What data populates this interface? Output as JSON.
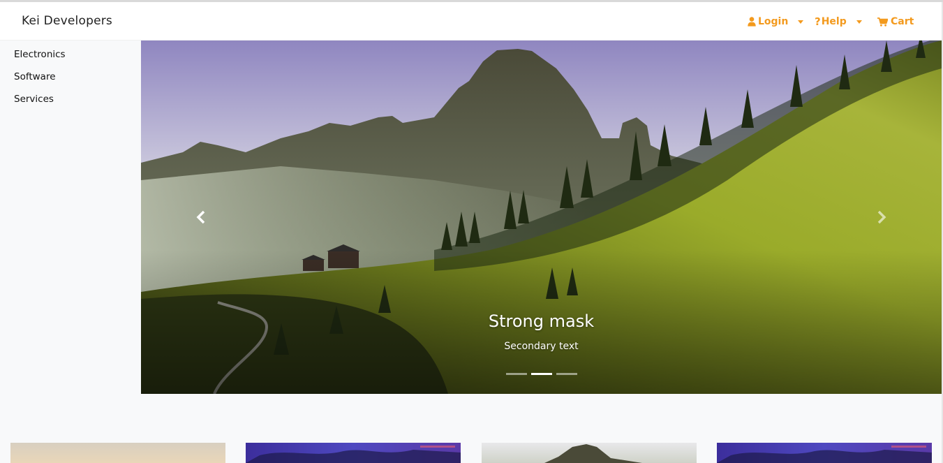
{
  "navbar": {
    "brand": "Kei Developers",
    "login_label": "Login",
    "help_label": "Help",
    "cart_label": "Cart",
    "accent_color": "#f39a1e"
  },
  "sidebar": {
    "items": [
      {
        "label": "Electronics"
      },
      {
        "label": "Software"
      },
      {
        "label": "Services"
      }
    ]
  },
  "carousel": {
    "caption_title": "Strong mask",
    "caption_text": "Secondary text",
    "slide_count": 3,
    "active_index": 1,
    "prev_icon": "chevron-left-icon",
    "next_icon": "chevron-right-icon"
  },
  "cards": [
    {
      "image": "sunset-landscape-image"
    },
    {
      "image": "purple-sky-image"
    },
    {
      "image": "mountain-image"
    },
    {
      "image": "purple-sky-image"
    }
  ]
}
